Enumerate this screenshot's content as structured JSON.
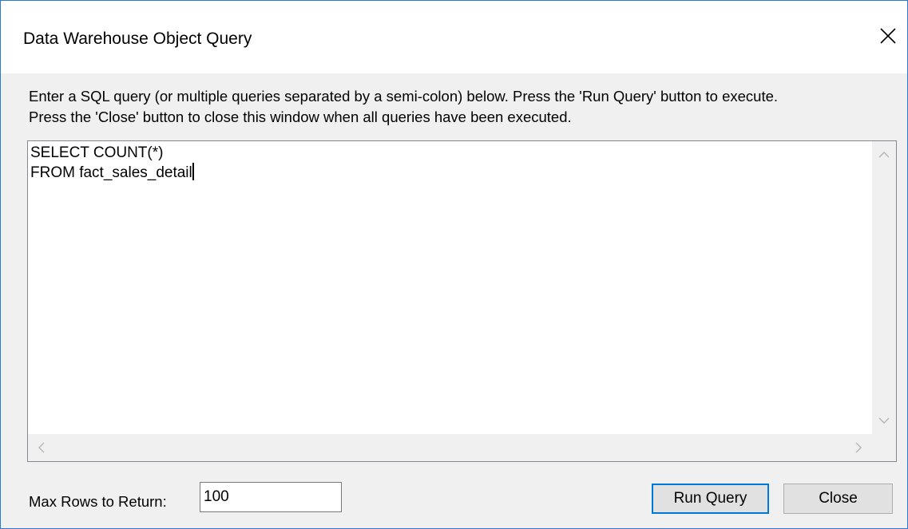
{
  "window": {
    "title": "Data Warehouse Object Query",
    "close_icon": "close-x-icon"
  },
  "instructions": {
    "line1": "Enter a SQL query (or multiple queries separated by a semi-colon) below. Press the 'Run Query' button to execute.",
    "line2": "Press the 'Close' button to close this window when all queries have been executed."
  },
  "editor": {
    "line1": "SELECT COUNT(*)",
    "line2": "FROM fact_sales_detail"
  },
  "footer": {
    "max_rows_label": "Max Rows to Return:",
    "max_rows_value": "100",
    "run_label": "Run Query",
    "close_label": "Close"
  },
  "colors": {
    "window_border": "#2b79d7",
    "default_button_border": "#0078d7",
    "dialog_bg": "#f0f0f0"
  }
}
